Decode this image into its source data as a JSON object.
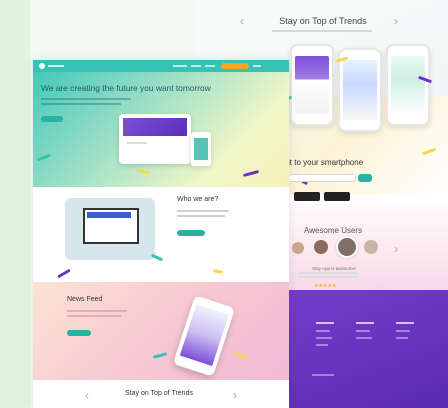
{
  "right_panel": {
    "header_title": "Stay on Top of Trends",
    "smartphone_heading": "it to your smartphone",
    "awesome_heading": "Awesome Users",
    "testimonial_heading": "Stay App is awesome!",
    "rating": "★★★★★"
  },
  "main_page": {
    "nav_cta": "",
    "hero_title": "We are creating the future you want tomorrow",
    "who_title": "Who we are?",
    "news_title": "News Feed",
    "bottom_title": "Stay on Top of Trends"
  },
  "icons": {
    "chevron_left": "‹",
    "chevron_right": "›"
  },
  "colors": {
    "teal": "#36c2b4",
    "purple": "#6b35c6",
    "yellow": "#f6d94a",
    "pink": "#f2b9d6"
  }
}
